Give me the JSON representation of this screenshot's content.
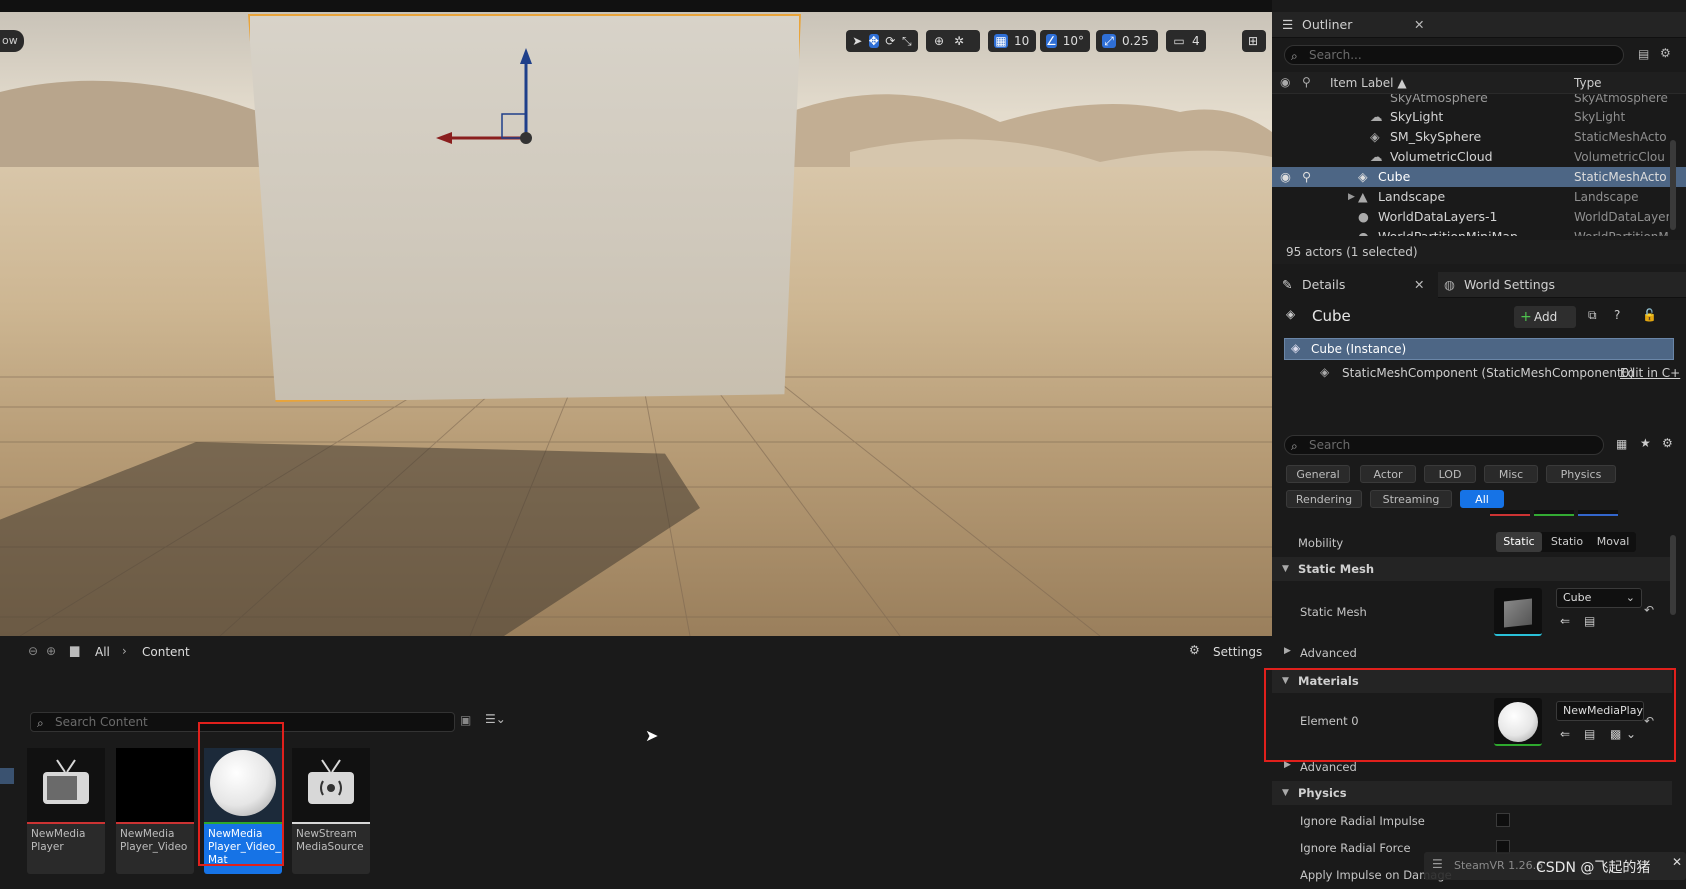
{
  "viewport": {
    "left_tab_label": "ow",
    "toolbar": {
      "grid_snap": "10",
      "rotation_snap": "10°",
      "scale_snap": "0.25",
      "camera_speed": "4"
    }
  },
  "outliner": {
    "tab_title": "Outliner",
    "search_placeholder": "Search...",
    "col_label": "Item Label ▲",
    "col_type": "Type",
    "items": [
      {
        "label": "SkyAtmosphere",
        "type": "SkyAtmosphere"
      },
      {
        "label": "SkyLight",
        "type": "SkyLight"
      },
      {
        "label": "SM_SkySphere",
        "type": "StaticMeshActo"
      },
      {
        "label": "VolumetricCloud",
        "type": "VolumetricClou"
      },
      {
        "label": "Cube",
        "type": "StaticMeshActo"
      },
      {
        "label": "Landscape",
        "type": "Landscape"
      },
      {
        "label": "WorldDataLayers-1",
        "type": "WorldDataLayer"
      },
      {
        "label": "WorldPartitionMiniMap",
        "type": "WorldPartitionM"
      }
    ],
    "status": "95 actors (1 selected)"
  },
  "details": {
    "tab_title": "Details",
    "world_settings_tab": "World Settings",
    "actor_name": "Cube",
    "add_label": "Add",
    "instance_label": "Cube (Instance)",
    "component_label": "StaticMeshComponent (StaticMeshComponent0)",
    "edit_link": "Edit in C+",
    "search_placeholder": "Search",
    "filters_row1": [
      "General",
      "Actor",
      "LOD",
      "Misc",
      "Physics"
    ],
    "filters_row2": [
      "Rendering",
      "Streaming",
      "All"
    ],
    "mobility_label": "Mobility",
    "mobility_options": [
      "Static",
      "Statio",
      "Moval"
    ],
    "static_mesh_section": "Static Mesh",
    "static_mesh_label": "Static Mesh",
    "static_mesh_value": "Cube",
    "advanced_label": "Advanced",
    "materials_section": "Materials",
    "element0_label": "Element 0",
    "element0_value": "NewMediaPlaye",
    "advanced2_label": "Advanced",
    "physics_section": "Physics",
    "physics_props": [
      "Ignore Radial Impulse",
      "Ignore Radial Force",
      "Apply Impulse on Damage"
    ]
  },
  "content_browser": {
    "breadcrumb_all": "All",
    "breadcrumb_content": "Content",
    "settings_label": "Settings",
    "search_placeholder": "Search Content",
    "assets": [
      {
        "name": "NewMedia Player"
      },
      {
        "name": "NewMedia Player_Video"
      },
      {
        "name": "NewMedia Player_Video_ Mat"
      },
      {
        "name": "NewStream MediaSource"
      }
    ]
  },
  "overlay": {
    "steamvr": "SteamVR 1.26.6",
    "watermark": "CSDN @飞起的猪"
  }
}
